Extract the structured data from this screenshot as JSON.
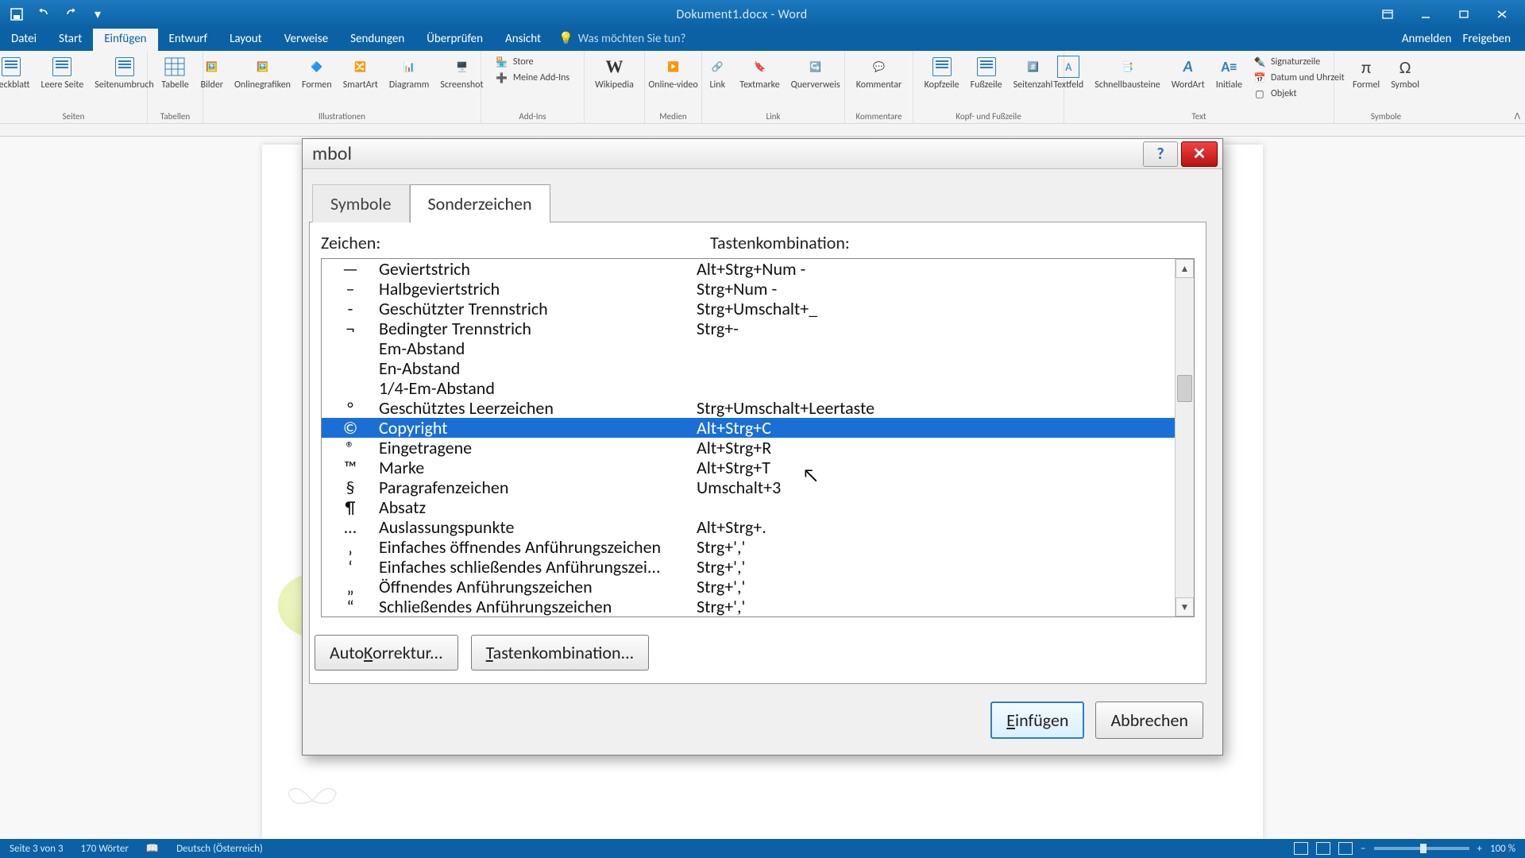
{
  "titlebar": {
    "doc_title": "Dokument1.docx - Word"
  },
  "ribbon_tabs": {
    "file": "Datei",
    "start": "Start",
    "insert": "Einfügen",
    "design": "Entwurf",
    "layout": "Layout",
    "references": "Verweise",
    "mailings": "Sendungen",
    "review": "Überprüfen",
    "view": "Ansicht",
    "tell_me": "Was möchten Sie tun?",
    "signin": "Anmelden",
    "share": "Freigeben"
  },
  "ribbon": {
    "cover": "Deckblatt",
    "blank": "Leere Seite",
    "pagebreak": "Seitenumbruch",
    "table": "Tabelle",
    "pictures": "Bilder",
    "online_pics": "Onlinegrafiken",
    "shapes": "Formen",
    "smartart": "SmartArt",
    "chart": "Diagramm",
    "screenshot": "Screenshot",
    "store": "Store",
    "myaddins": "Meine Add-Ins",
    "wikipedia": "Wikipedia",
    "onlinevideo": "Online-video",
    "link": "Link",
    "bookmark": "Textmarke",
    "crossref": "Querverweis",
    "comment": "Kommentar",
    "header": "Kopfzeile",
    "footer": "Fußzeile",
    "pagenum": "Seitenzahl",
    "textbox": "Textfeld",
    "quickparts": "Schnellbausteine",
    "wordart": "WordArt",
    "dropcap": "Initiale",
    "sigline": "Signaturzeile",
    "datetime": "Datum und Uhrzeit",
    "object": "Objekt",
    "equation": "Formel",
    "symbol": "Symbol",
    "g_pages": "Seiten",
    "g_tables": "Tabellen",
    "g_illus": "Illustrationen",
    "g_addins": "Add-Ins",
    "g_media": "Medien",
    "g_links": "Link",
    "g_comments": "Kommentare",
    "g_hf": "Kopf- und Fußzeile",
    "g_text": "Text",
    "g_symbols": "Symbole"
  },
  "dialog": {
    "title": "mbol",
    "tab_symbols": "Symbole",
    "tab_special": "Sonderzeichen",
    "col_char": "Zeichen:",
    "col_shortcut": "Tastenkombination:",
    "rows": [
      {
        "sym": "—",
        "name": "Geviertstrich",
        "key": "Alt+Strg+Num -"
      },
      {
        "sym": "–",
        "name": "Halbgeviertstrich",
        "key": "Strg+Num -"
      },
      {
        "sym": "-",
        "name": "Geschützter Trennstrich",
        "key": "Strg+Umschalt+_"
      },
      {
        "sym": "¬",
        "name": "Bedingter Trennstrich",
        "key": "Strg+-"
      },
      {
        "sym": "",
        "name": "Em-Abstand",
        "key": ""
      },
      {
        "sym": "",
        "name": "En-Abstand",
        "key": ""
      },
      {
        "sym": "",
        "name": "1/4-Em-Abstand",
        "key": ""
      },
      {
        "sym": "°",
        "name": "Geschütztes Leerzeichen",
        "key": "Strg+Umschalt+Leertaste"
      },
      {
        "sym": "©",
        "name": "Copyright",
        "key": "Alt+Strg+C",
        "selected": true
      },
      {
        "sym": "®",
        "name": "Eingetragene",
        "key": "Alt+Strg+R"
      },
      {
        "sym": "™",
        "name": "Marke",
        "key": "Alt+Strg+T"
      },
      {
        "sym": "§",
        "name": "Paragrafenzeichen",
        "key": "Umschalt+3"
      },
      {
        "sym": "¶",
        "name": "Absatz",
        "key": ""
      },
      {
        "sym": "…",
        "name": "Auslassungspunkte",
        "key": "Alt+Strg+."
      },
      {
        "sym": "‚",
        "name": "Einfaches öffnendes Anführungszeichen",
        "key": "Strg+','"
      },
      {
        "sym": "‘",
        "name": "Einfaches schließendes Anführungszei...",
        "key": "Strg+','"
      },
      {
        "sym": "„",
        "name": "Öffnendes Anführungszeichen",
        "key": "Strg+','"
      },
      {
        "sym": "“",
        "name": "Schließendes Anführungszeichen",
        "key": "Strg+','"
      }
    ],
    "autocorrect": "AutoKorrektur...",
    "shortcut_btn": "Tastenkombination...",
    "insert": "Einfügen",
    "cancel": "Abbrechen"
  },
  "statusbar": {
    "page": "Seite 3 von 3",
    "words": "170 Wörter",
    "lang": "Deutsch (Österreich)",
    "zoom": "100 %"
  }
}
